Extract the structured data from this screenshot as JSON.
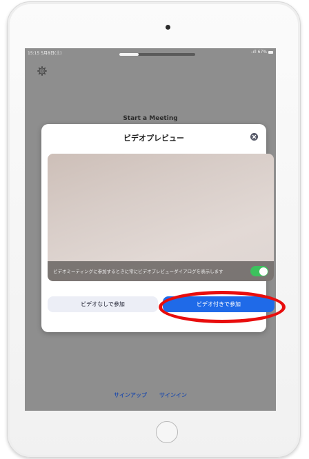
{
  "statusbar": {
    "time": "15:15 5月8日(土)",
    "signal": "₊ıll",
    "battery_percent": "67%"
  },
  "background": {
    "title": "Start a Meeting"
  },
  "dialog": {
    "title": "ビデオプレビュー",
    "notice": "ビデオミーティングに参加するときに常にビデオプレビューダイアログを表示します",
    "toggle_on": true,
    "join_without_video": "ビデオなしで参加",
    "join_with_video": "ビデオ付きで参加"
  },
  "footer": {
    "sign_up": "サインアップ",
    "sign_in": "サインイン"
  },
  "colors": {
    "primary": "#1f6ae8",
    "toggle": "#3cc25d",
    "highlight": "#e80d0d"
  },
  "icons": {
    "settings": "gear-icon",
    "close": "close-icon"
  }
}
